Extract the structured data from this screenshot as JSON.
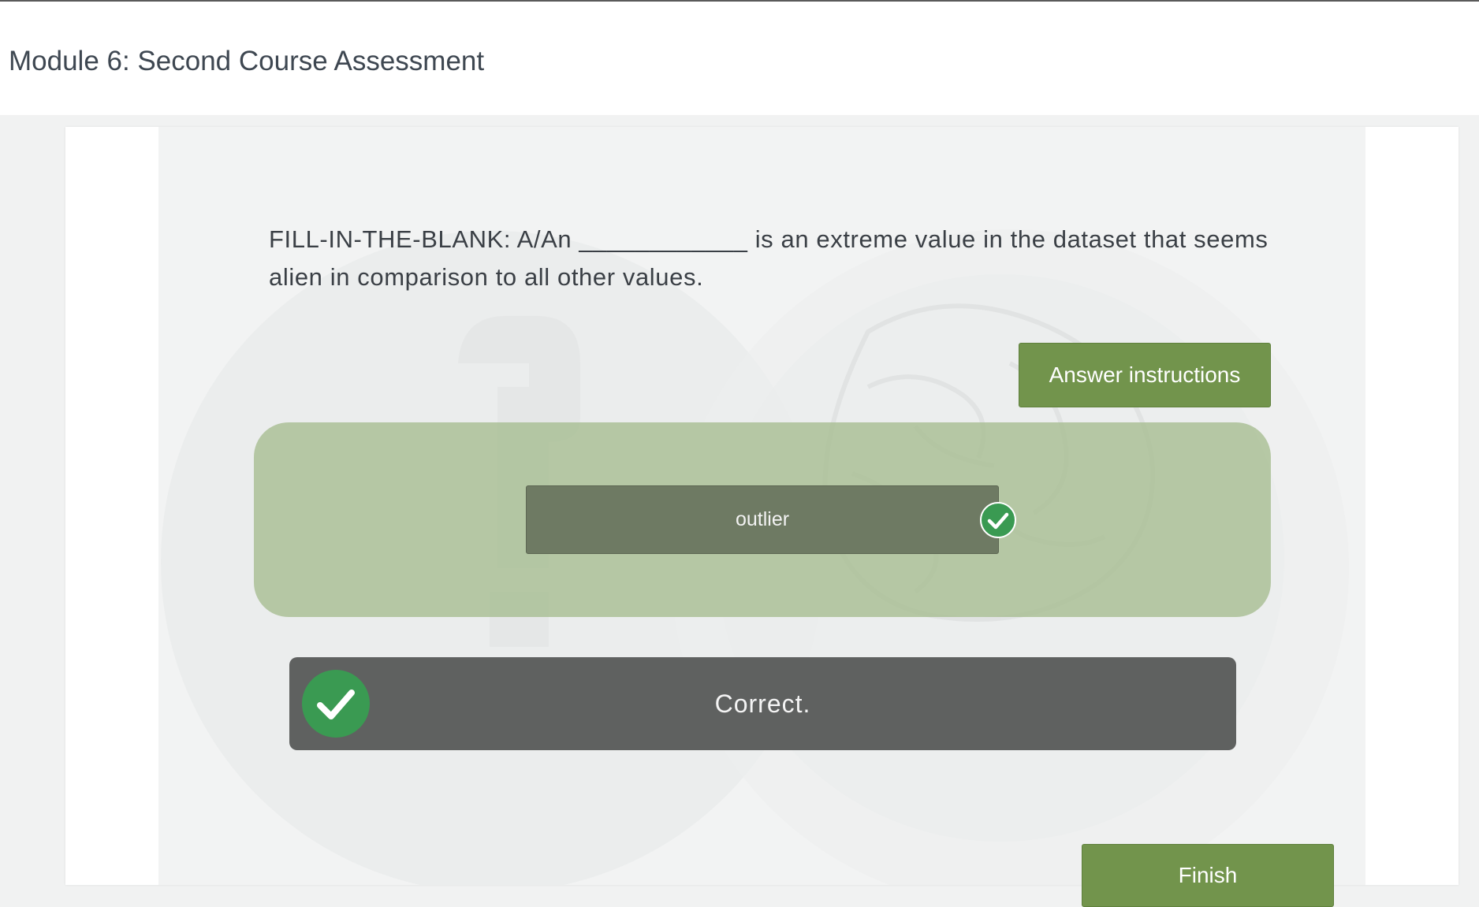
{
  "header": {
    "title": "Module 6: Second Course Assessment"
  },
  "question": {
    "text": "FILL-IN-THE-BLANK: A/An ____________ is an extreme value in the dataset that seems alien in comparison to all other values."
  },
  "buttons": {
    "answer_instructions": "Answer instructions",
    "finish": "Finish"
  },
  "answer": {
    "value": "outlier",
    "status": "correct"
  },
  "feedback": {
    "text": "Correct."
  },
  "colors": {
    "accent_green": "#72944c",
    "check_green": "#3a9a52",
    "feedback_bg": "#5f6160",
    "drop_zone": "#a5bd90"
  },
  "icons": {
    "answer_check": "check-circle-icon",
    "feedback_check": "check-circle-icon",
    "background": "quiz-watermark-icon"
  }
}
